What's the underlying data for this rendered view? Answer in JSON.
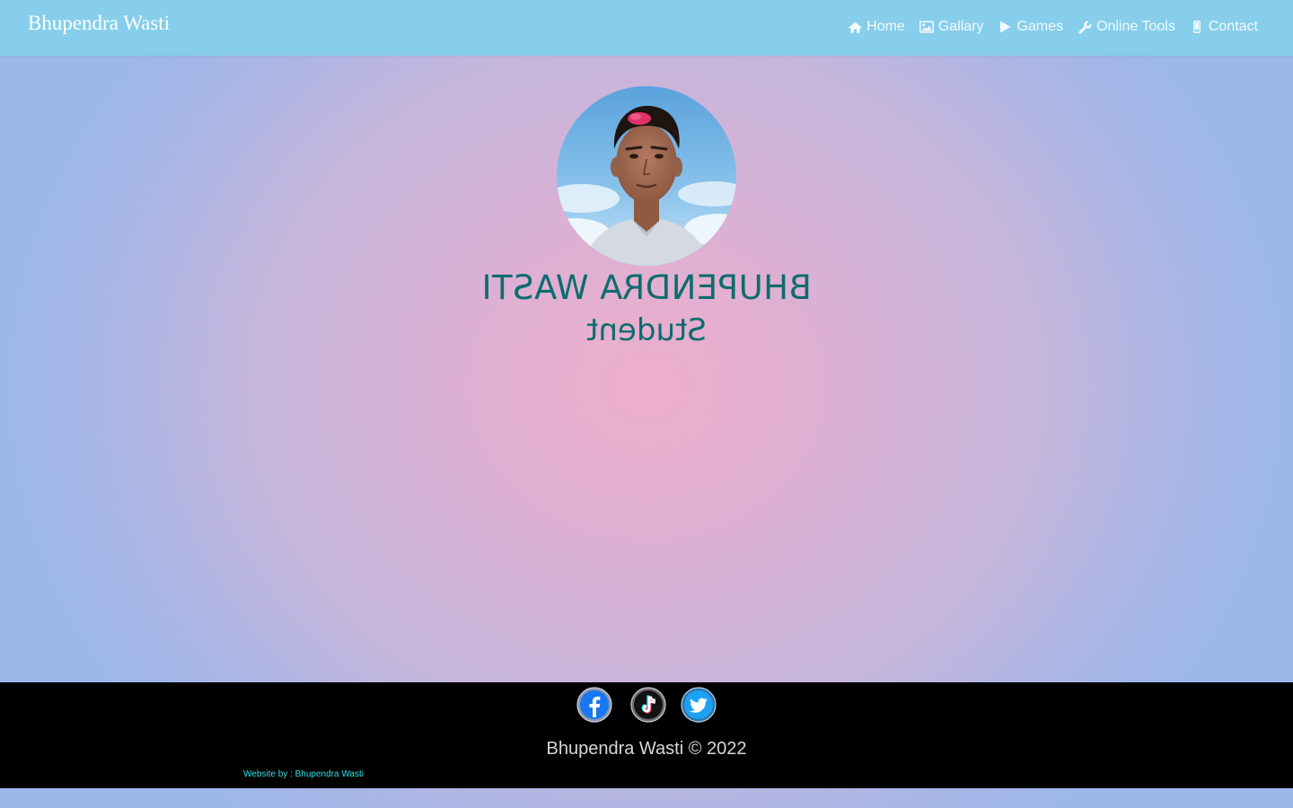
{
  "navbar": {
    "brand": "Bhupendra Wasti",
    "links": [
      {
        "label": "Home",
        "icon": "home-icon"
      },
      {
        "label": "Gallary",
        "icon": "image-icon"
      },
      {
        "label": "Games",
        "icon": "play-icon"
      },
      {
        "label": "Online Tools",
        "icon": "wrench-icon"
      },
      {
        "label": "Contact",
        "icon": "mobile-icon"
      }
    ],
    "background": "#86ceeb"
  },
  "profile": {
    "name": "BHUPENDRA WASTI",
    "role": "Student",
    "text_color": "#0d6c6f",
    "text_mirrored": true
  },
  "footer": {
    "social": [
      {
        "name": "facebook",
        "icon": "facebook-icon"
      },
      {
        "name": "tiktok",
        "icon": "tiktok-icon"
      },
      {
        "name": "twitter",
        "icon": "twitter-icon"
      }
    ],
    "copyright": "Bhupendra Wasti © 2022",
    "credit": "Website by : Bhupendra Wasti",
    "background": "#000000",
    "credit_color": "#35dfe6"
  },
  "colors": {
    "page_gradient_center": "#eeaecb",
    "page_gradient_edge": "#9bb8ea"
  }
}
